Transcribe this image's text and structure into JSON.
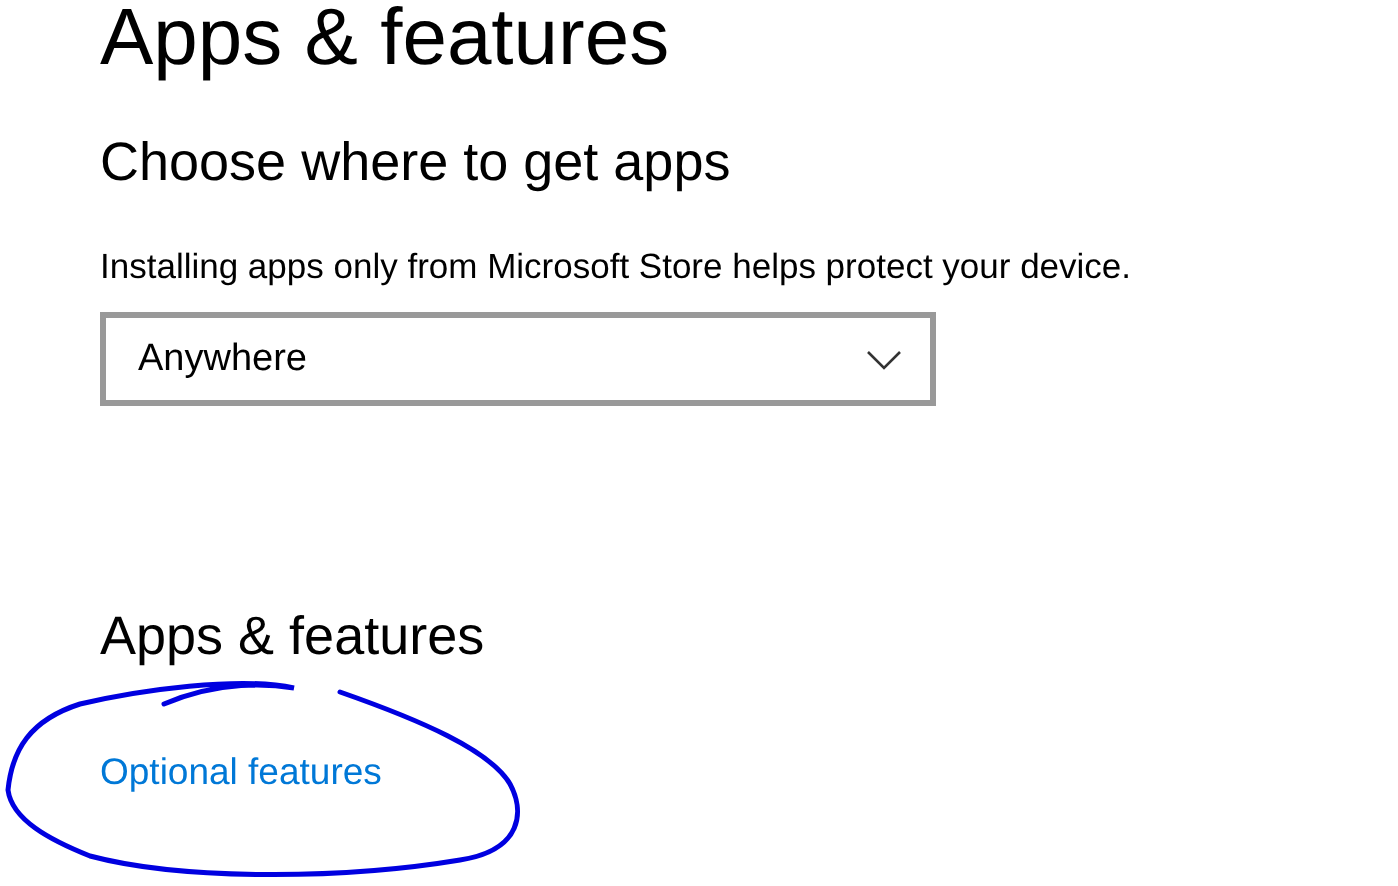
{
  "page_title": "Apps & features",
  "source_section": {
    "heading": "Choose where to get apps",
    "description": "Installing apps only from Microsoft Store helps protect your device.",
    "dropdown": {
      "value": "Anywhere"
    }
  },
  "apps_section": {
    "heading": "Apps & features",
    "links": [
      "Optional features"
    ]
  },
  "annotation": {
    "kind": "ellipse",
    "color": "#0000e0"
  }
}
